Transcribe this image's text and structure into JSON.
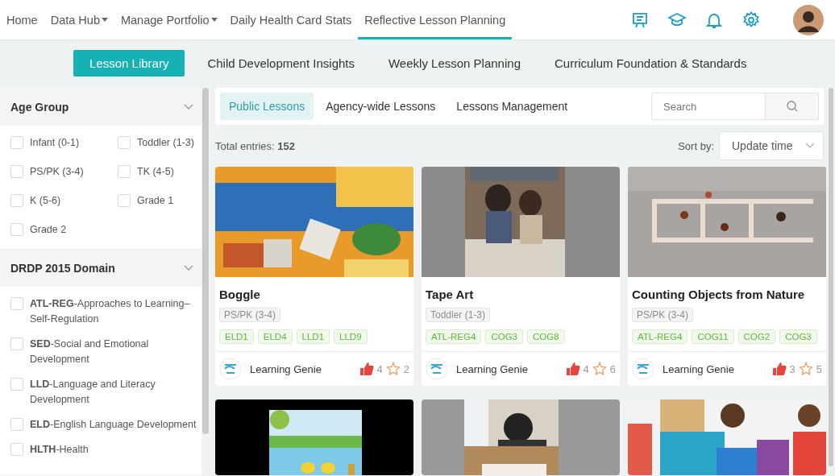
{
  "nav": {
    "items": [
      {
        "label": "Home",
        "dropdown": false,
        "selected": false
      },
      {
        "label": "Data Hub",
        "dropdown": true,
        "selected": false
      },
      {
        "label": "Manage Portfolio",
        "dropdown": true,
        "selected": false
      },
      {
        "label": "Daily Health Card Stats",
        "dropdown": false,
        "selected": false
      },
      {
        "label": "Reflective Lesson Planning",
        "dropdown": false,
        "selected": true
      }
    ]
  },
  "sub_tabs": [
    {
      "label": "Lesson Library",
      "selected": true
    },
    {
      "label": "Child Development Insights",
      "selected": false
    },
    {
      "label": "Weekly Lesson Planning",
      "selected": false
    },
    {
      "label": "Curriculum Foundation & Standards",
      "selected": false
    }
  ],
  "filters": [
    {
      "title": "Age Group",
      "kind": "grid",
      "expanded": true,
      "options": [
        {
          "label": "Infant (0-1)",
          "checked": false
        },
        {
          "label": "Toddler (1-3)",
          "checked": false
        },
        {
          "label": "PS/PK (3-4)",
          "checked": false
        },
        {
          "label": "TK (4-5)",
          "checked": false
        },
        {
          "label": "K (5-6)",
          "checked": false
        },
        {
          "label": "Grade 1",
          "checked": false
        },
        {
          "label": "Grade 2",
          "checked": false
        }
      ]
    },
    {
      "title": "DRDP 2015 Domain",
      "kind": "list",
      "expanded": true,
      "options": [
        {
          "label": "**ATL-REG**-Approaches to Learning–Self-Regulation",
          "checked": false
        },
        {
          "label": "**SED**-Social and Emotional Development",
          "checked": false
        },
        {
          "label": "**LLD**-Language and Literacy Development",
          "checked": false
        },
        {
          "label": "**ELD**-English Language Development",
          "checked": false
        },
        {
          "label": "**HLTH**-Health",
          "checked": false
        }
      ]
    }
  ],
  "lesson_tabs": [
    {
      "label": "Public Lessons",
      "selected": true
    },
    {
      "label": "Agency-wide Lessons",
      "selected": false
    },
    {
      "label": "Lessons Management",
      "selected": false
    }
  ],
  "search": {
    "placeholder": "Search"
  },
  "total_entries": "Total entries: **152**",
  "sort": {
    "label": "Sort by:",
    "value": "Update time"
  },
  "cards": [
    {
      "kind": "lesson",
      "title": "Boggle",
      "age": "PS/PK (3-4)",
      "tags": [
        "ELD1",
        "ELD4",
        "LLD1",
        "LLD9"
      ],
      "author": "Learning Genie",
      "likes": "4",
      "favorites": "2"
    },
    {
      "kind": "lesson",
      "title": "Tape Art",
      "age": "Toddler (1-3)",
      "tags": [
        "ATL-REG4",
        "COG3",
        "COG8"
      ],
      "author": "Learning Genie",
      "likes": "4",
      "favorites": "6"
    },
    {
      "kind": "lesson",
      "title": "Counting Objects from Nature",
      "age": "PS/PK (3-4)",
      "tags": [
        "ATL-REG4",
        "COG11",
        "COG2",
        "COG3"
      ],
      "author": "Learning Genie",
      "likes": "3",
      "favorites": "5"
    },
    {
      "kind": "picture"
    },
    {
      "kind": "picture"
    },
    {
      "kind": "picture"
    }
  ]
}
